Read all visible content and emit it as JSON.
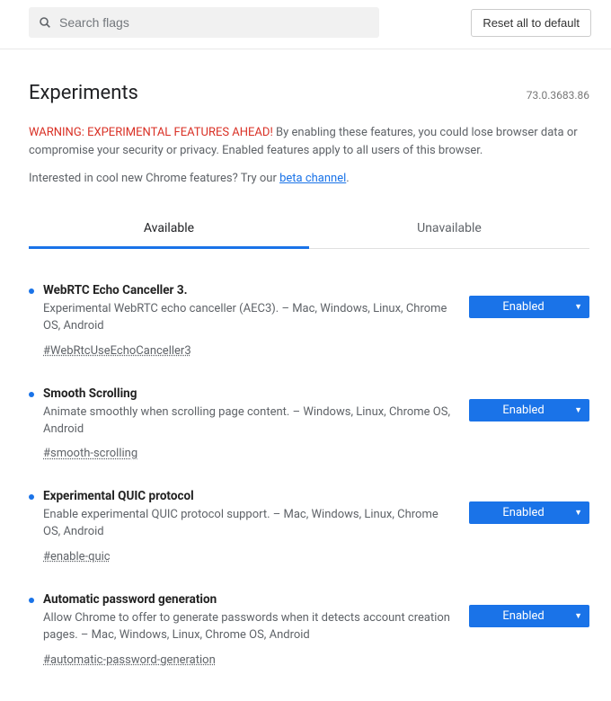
{
  "search": {
    "placeholder": "Search flags"
  },
  "reset_button_label": "Reset all to default",
  "page_title": "Experiments",
  "version": "73.0.3683.86",
  "warning_bold": "WARNING: EXPERIMENTAL FEATURES AHEAD!",
  "warning_rest": " By enabling these features, you could lose browser data or compromise your security or privacy. Enabled features apply to all users of this browser.",
  "interest_prefix": "Interested in cool new Chrome features? Try our ",
  "interest_link": "beta channel",
  "interest_suffix": ".",
  "tabs": {
    "available": "Available",
    "unavailable": "Unavailable"
  },
  "flags": [
    {
      "title": "WebRTC Echo Canceller 3.",
      "desc": "Experimental WebRTC echo canceller (AEC3). – Mac, Windows, Linux, Chrome OS, Android",
      "hash": "#WebRtcUseEchoCanceller3",
      "value": "Enabled"
    },
    {
      "title": "Smooth Scrolling",
      "desc": "Animate smoothly when scrolling page content. – Windows, Linux, Chrome OS, Android",
      "hash": "#smooth-scrolling",
      "value": "Enabled"
    },
    {
      "title": "Experimental QUIC protocol",
      "desc": "Enable experimental QUIC protocol support. – Mac, Windows, Linux, Chrome OS, Android",
      "hash": "#enable-quic",
      "value": "Enabled"
    },
    {
      "title": "Automatic password generation",
      "desc": "Allow Chrome to offer to generate passwords when it detects account creation pages. – Mac, Windows, Linux, Chrome OS, Android",
      "hash": "#automatic-password-generation",
      "value": "Enabled"
    }
  ]
}
